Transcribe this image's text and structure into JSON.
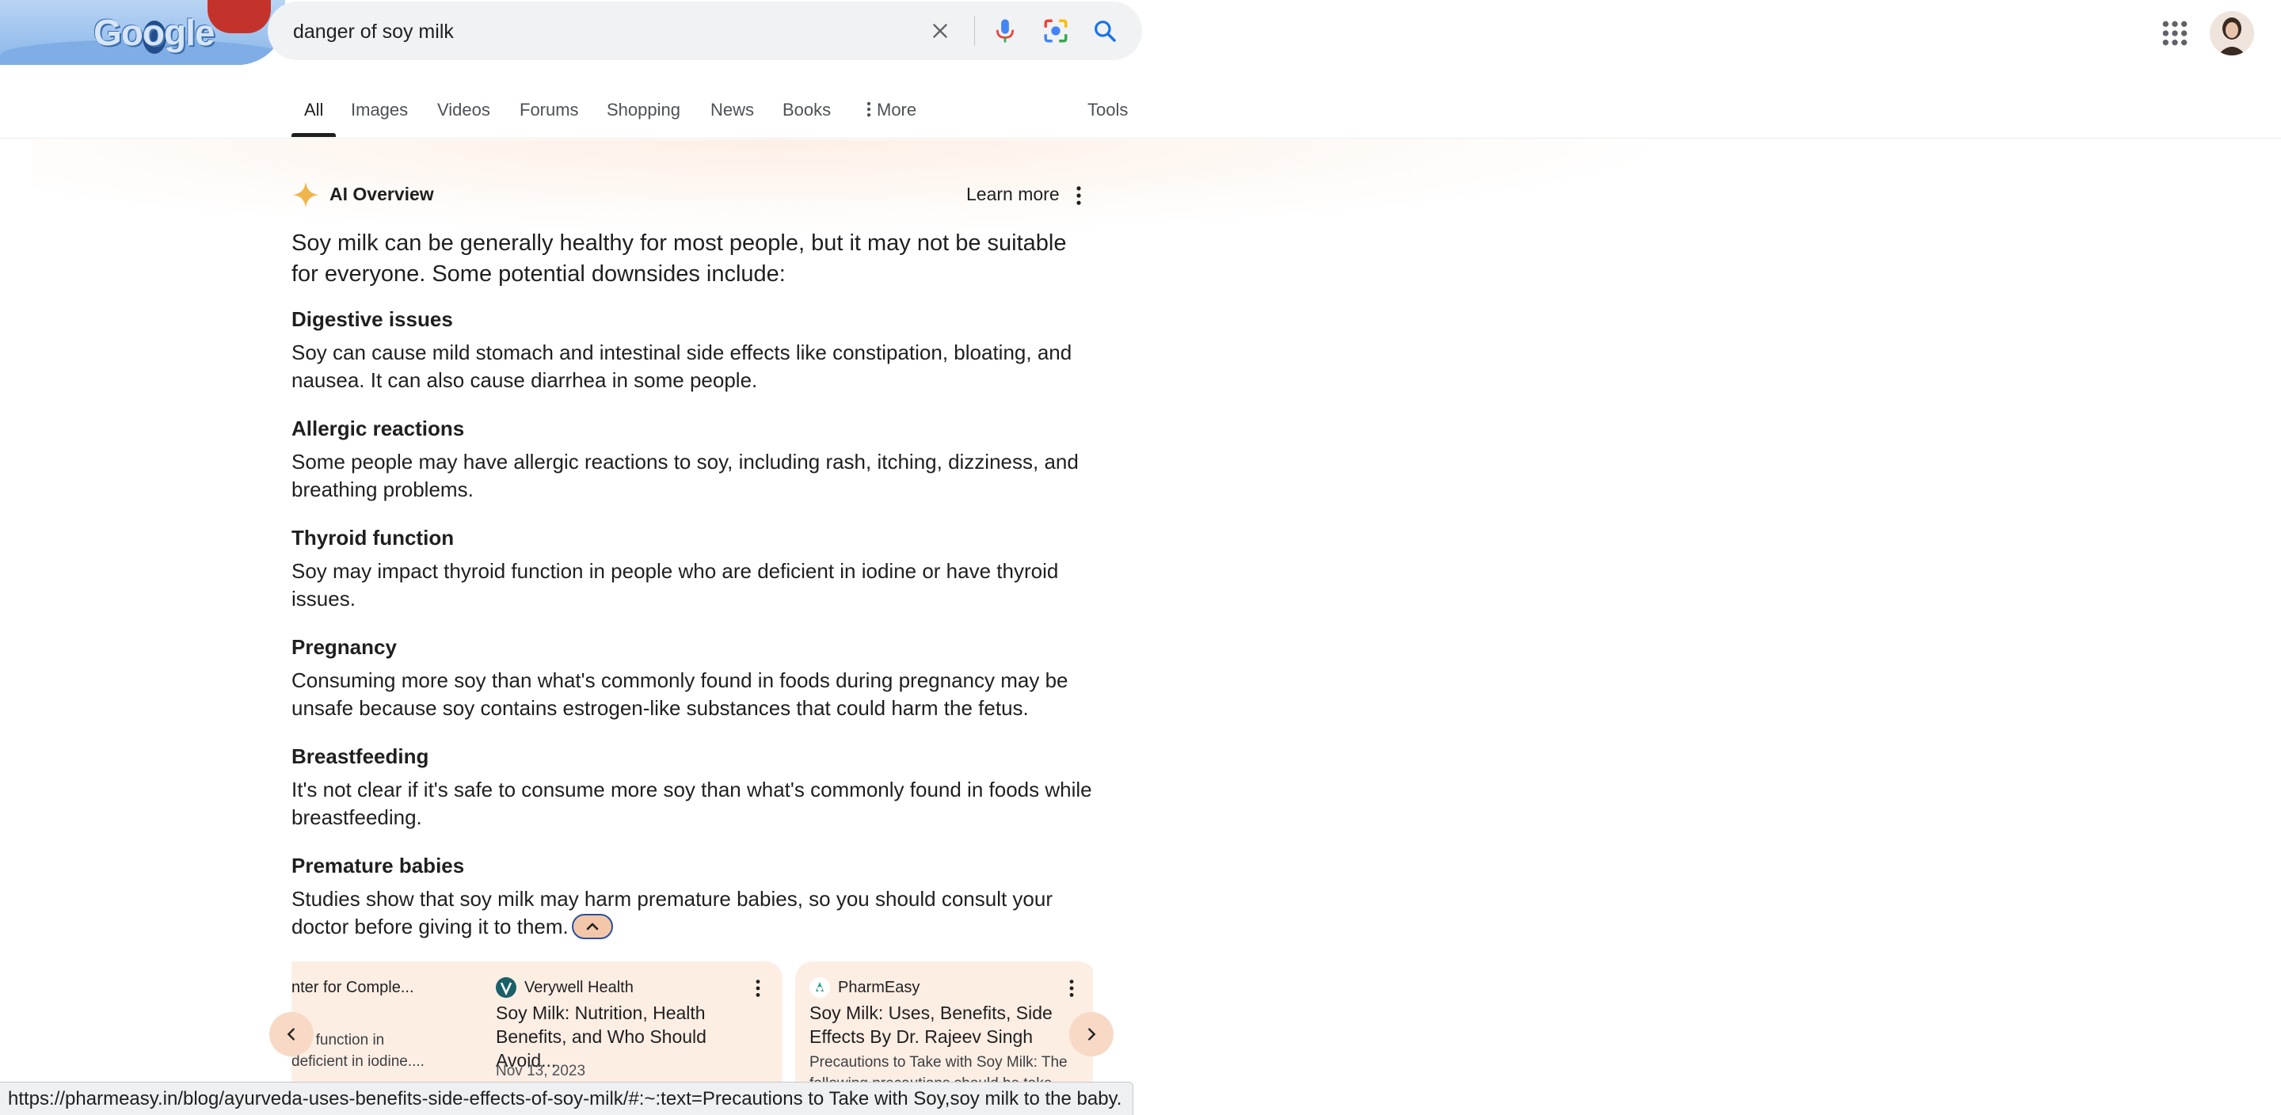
{
  "header": {
    "logo_text": "Google",
    "search_query": "danger of soy milk"
  },
  "tabs": [
    {
      "label": "All",
      "active": true
    },
    {
      "label": "Images"
    },
    {
      "label": "Videos"
    },
    {
      "label": "Forums"
    },
    {
      "label": "Shopping"
    },
    {
      "label": "News"
    },
    {
      "label": "Books"
    },
    {
      "label": "More"
    },
    {
      "label": "Tools"
    }
  ],
  "ai_overview": {
    "title": "AI Overview",
    "learn_more": "Learn more",
    "lead": "Soy milk can be generally healthy for most people, but it may not be suitable for everyone. Some potential downsides include:",
    "sections": [
      {
        "title": "Digestive issues",
        "body": "Soy can cause mild stomach and intestinal side effects like constipation, bloating, and nausea. It can also cause diarrhea in some people."
      },
      {
        "title": "Allergic reactions",
        "body": "Some people may have allergic reactions to soy, including rash, itching, dizziness, and breathing problems."
      },
      {
        "title": "Thyroid function",
        "body": "Soy may impact thyroid function in people who are deficient in iodine or have thyroid issues."
      },
      {
        "title": "Pregnancy",
        "body": "Consuming more soy than what's commonly found in foods during pregnancy may be unsafe because soy contains estrogen-like substances that could harm the fetus."
      },
      {
        "title": "Breastfeeding",
        "body": "It's not clear if it's safe to consume more soy than what's commonly found in foods while breastfeeding."
      },
      {
        "title": "Premature babies",
        "body": "Studies show that soy milk may harm premature babies, so you should consult your doctor before giving it to them."
      }
    ]
  },
  "cards": [
    {
      "source": "nter for Comple...",
      "snippet": "oid function in\ndeficient in iodine...."
    },
    {
      "source": "Verywell Health",
      "title": "Soy Milk: Nutrition, Health Benefits, and Who Should Avoid...",
      "date": "Nov 13, 2023"
    },
    {
      "source": "PharmEasy",
      "title": "Soy Milk: Uses, Benefits, Side Effects By Dr. Rajeev Singh",
      "snippet": "Precautions to Take with Soy Milk: The following precautions should be take..."
    }
  ],
  "status_url": "https://pharmeasy.in/blog/ayurveda-uses-benefits-side-effects-of-soy-milk/#:~:text=Precautions to Take with Soy,soy milk to the baby.",
  "colors": {
    "accent_blue": "#1a73e8",
    "card_bg": "#fdeee4",
    "spark_gold": "#f0b44c"
  }
}
